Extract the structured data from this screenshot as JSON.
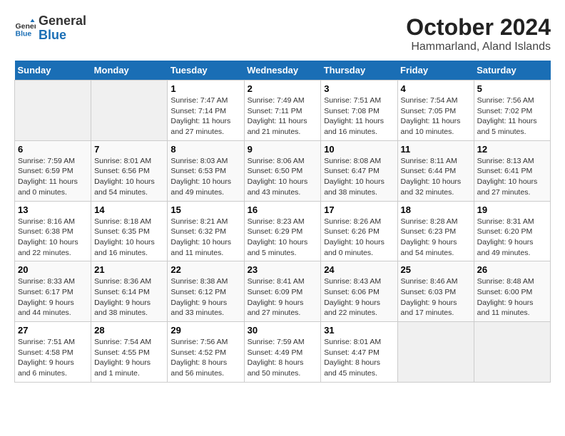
{
  "header": {
    "logo_line1": "General",
    "logo_line2": "Blue",
    "month": "October 2024",
    "location": "Hammarland, Aland Islands"
  },
  "days_of_week": [
    "Sunday",
    "Monday",
    "Tuesday",
    "Wednesday",
    "Thursday",
    "Friday",
    "Saturday"
  ],
  "weeks": [
    [
      {
        "day": "",
        "detail": ""
      },
      {
        "day": "",
        "detail": ""
      },
      {
        "day": "1",
        "detail": "Sunrise: 7:47 AM\nSunset: 7:14 PM\nDaylight: 11 hours and 27 minutes."
      },
      {
        "day": "2",
        "detail": "Sunrise: 7:49 AM\nSunset: 7:11 PM\nDaylight: 11 hours and 21 minutes."
      },
      {
        "day": "3",
        "detail": "Sunrise: 7:51 AM\nSunset: 7:08 PM\nDaylight: 11 hours and 16 minutes."
      },
      {
        "day": "4",
        "detail": "Sunrise: 7:54 AM\nSunset: 7:05 PM\nDaylight: 11 hours and 10 minutes."
      },
      {
        "day": "5",
        "detail": "Sunrise: 7:56 AM\nSunset: 7:02 PM\nDaylight: 11 hours and 5 minutes."
      }
    ],
    [
      {
        "day": "6",
        "detail": "Sunrise: 7:59 AM\nSunset: 6:59 PM\nDaylight: 11 hours and 0 minutes."
      },
      {
        "day": "7",
        "detail": "Sunrise: 8:01 AM\nSunset: 6:56 PM\nDaylight: 10 hours and 54 minutes."
      },
      {
        "day": "8",
        "detail": "Sunrise: 8:03 AM\nSunset: 6:53 PM\nDaylight: 10 hours and 49 minutes."
      },
      {
        "day": "9",
        "detail": "Sunrise: 8:06 AM\nSunset: 6:50 PM\nDaylight: 10 hours and 43 minutes."
      },
      {
        "day": "10",
        "detail": "Sunrise: 8:08 AM\nSunset: 6:47 PM\nDaylight: 10 hours and 38 minutes."
      },
      {
        "day": "11",
        "detail": "Sunrise: 8:11 AM\nSunset: 6:44 PM\nDaylight: 10 hours and 32 minutes."
      },
      {
        "day": "12",
        "detail": "Sunrise: 8:13 AM\nSunset: 6:41 PM\nDaylight: 10 hours and 27 minutes."
      }
    ],
    [
      {
        "day": "13",
        "detail": "Sunrise: 8:16 AM\nSunset: 6:38 PM\nDaylight: 10 hours and 22 minutes."
      },
      {
        "day": "14",
        "detail": "Sunrise: 8:18 AM\nSunset: 6:35 PM\nDaylight: 10 hours and 16 minutes."
      },
      {
        "day": "15",
        "detail": "Sunrise: 8:21 AM\nSunset: 6:32 PM\nDaylight: 10 hours and 11 minutes."
      },
      {
        "day": "16",
        "detail": "Sunrise: 8:23 AM\nSunset: 6:29 PM\nDaylight: 10 hours and 5 minutes."
      },
      {
        "day": "17",
        "detail": "Sunrise: 8:26 AM\nSunset: 6:26 PM\nDaylight: 10 hours and 0 minutes."
      },
      {
        "day": "18",
        "detail": "Sunrise: 8:28 AM\nSunset: 6:23 PM\nDaylight: 9 hours and 54 minutes."
      },
      {
        "day": "19",
        "detail": "Sunrise: 8:31 AM\nSunset: 6:20 PM\nDaylight: 9 hours and 49 minutes."
      }
    ],
    [
      {
        "day": "20",
        "detail": "Sunrise: 8:33 AM\nSunset: 6:17 PM\nDaylight: 9 hours and 44 minutes."
      },
      {
        "day": "21",
        "detail": "Sunrise: 8:36 AM\nSunset: 6:14 PM\nDaylight: 9 hours and 38 minutes."
      },
      {
        "day": "22",
        "detail": "Sunrise: 8:38 AM\nSunset: 6:12 PM\nDaylight: 9 hours and 33 minutes."
      },
      {
        "day": "23",
        "detail": "Sunrise: 8:41 AM\nSunset: 6:09 PM\nDaylight: 9 hours and 27 minutes."
      },
      {
        "day": "24",
        "detail": "Sunrise: 8:43 AM\nSunset: 6:06 PM\nDaylight: 9 hours and 22 minutes."
      },
      {
        "day": "25",
        "detail": "Sunrise: 8:46 AM\nSunset: 6:03 PM\nDaylight: 9 hours and 17 minutes."
      },
      {
        "day": "26",
        "detail": "Sunrise: 8:48 AM\nSunset: 6:00 PM\nDaylight: 9 hours and 11 minutes."
      }
    ],
    [
      {
        "day": "27",
        "detail": "Sunrise: 7:51 AM\nSunset: 4:58 PM\nDaylight: 9 hours and 6 minutes."
      },
      {
        "day": "28",
        "detail": "Sunrise: 7:54 AM\nSunset: 4:55 PM\nDaylight: 9 hours and 1 minute."
      },
      {
        "day": "29",
        "detail": "Sunrise: 7:56 AM\nSunset: 4:52 PM\nDaylight: 8 hours and 56 minutes."
      },
      {
        "day": "30",
        "detail": "Sunrise: 7:59 AM\nSunset: 4:49 PM\nDaylight: 8 hours and 50 minutes."
      },
      {
        "day": "31",
        "detail": "Sunrise: 8:01 AM\nSunset: 4:47 PM\nDaylight: 8 hours and 45 minutes."
      },
      {
        "day": "",
        "detail": ""
      },
      {
        "day": "",
        "detail": ""
      }
    ]
  ]
}
